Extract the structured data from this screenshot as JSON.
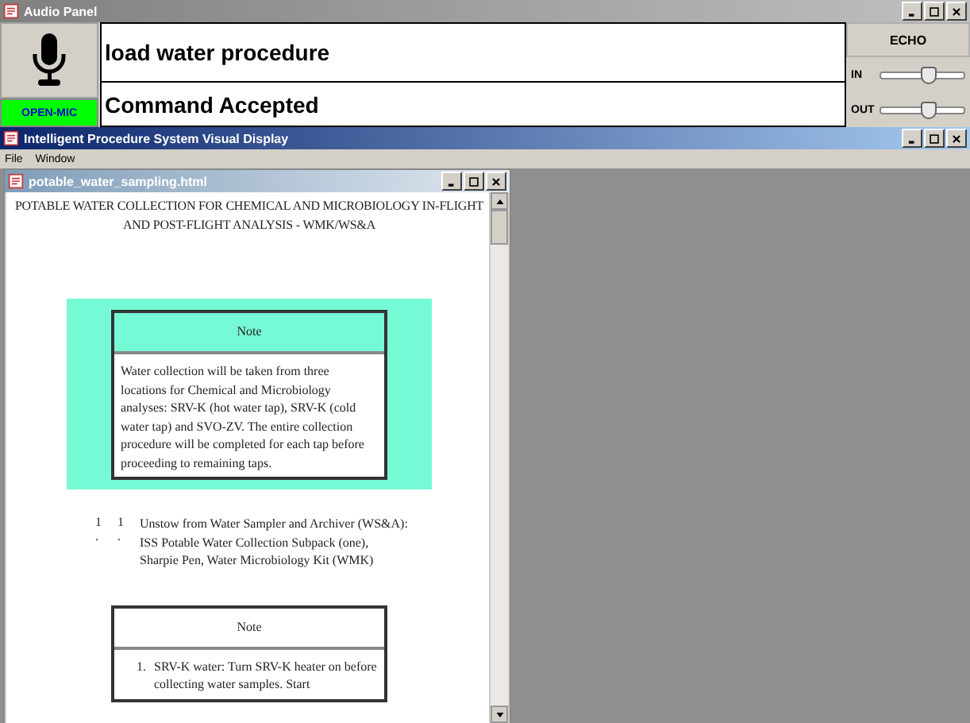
{
  "audio_panel": {
    "title": "Audio Panel",
    "command": "load water procedure",
    "response": "Command Accepted",
    "mic_status": "OPEN-MIC",
    "mic_open": true,
    "echo_button": "ECHO",
    "sliders": [
      {
        "label": "IN",
        "level": 0.55
      },
      {
        "label": "OUT",
        "level": 0.55
      }
    ]
  },
  "main_window": {
    "title": "Intelligent Procedure System Visual Display",
    "menu": [
      "File",
      "Window"
    ],
    "document": {
      "title": "potable_water_sampling.html",
      "heading": "POTABLE WATER COLLECTION FOR CHEMICAL AND MICROBIOLOGY IN-FLIGHT AND POST-FLIGHT ANALYSIS - WMK/WS&A",
      "blocks": [
        {
          "kind": "note",
          "highlighted": true,
          "header": "Note",
          "body": "Water collection will be taken from three locations for Chemical and Microbiology analyses: SRV-K (hot water tap), SRV-K (cold water tap) and SVO-ZV. The entire collection procedure will be completed for each tap before proceeding to remaining taps."
        },
        {
          "kind": "step",
          "outer_marker": [
            "1",
            "."
          ],
          "inner_marker": [
            "1",
            "."
          ],
          "text": "Unstow from Water Sampler and Archiver (WS&A): ISS Potable Water Collection Subpack (one), Sharpie Pen, Water Microbiology Kit (WMK)"
        },
        {
          "kind": "note",
          "highlighted": false,
          "header": "Note",
          "items": [
            {
              "number": "1.",
              "text": "SRV-K water: Turn SRV-K heater on before collecting water samples. Start"
            }
          ]
        }
      ]
    }
  }
}
